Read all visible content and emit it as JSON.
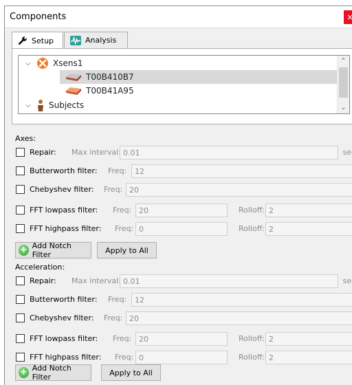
{
  "window": {
    "title": "Components",
    "close_glyph": "×"
  },
  "tabs": [
    {
      "label": "Setup",
      "icon": "wrench-icon",
      "active": true
    },
    {
      "label": "Analysis",
      "icon": "waveform-icon",
      "active": false
    }
  ],
  "tree": {
    "items": [
      {
        "label": "Xsens1",
        "icon": "xsens-device-icon",
        "expanded": true,
        "level": 0
      },
      {
        "label": "T00B410B7",
        "icon": "sensor-icon",
        "level": 1,
        "selected": true
      },
      {
        "label": "T00B41A95",
        "icon": "sensor-icon",
        "level": 1,
        "selected": false
      },
      {
        "label": "Subjects",
        "icon": "subject-icon",
        "expanded": true,
        "level": 0
      }
    ]
  },
  "sections": [
    {
      "title": "Axes:",
      "repair": {
        "label": "Repair:",
        "field_label": "Max interval:",
        "value": "0.01",
        "unit": "sec"
      },
      "butterworth": {
        "label": "Butterworth filter:",
        "field_label": "Freq:",
        "value": "12"
      },
      "chebyshev": {
        "label": "Chebyshev filter:",
        "field_label": "Freq:",
        "value": "20"
      },
      "fft_lowpass": {
        "label": "FFT lowpass filter:",
        "field_label": "Freq:",
        "value": "20",
        "rolloff_label": "Rolloff:",
        "rolloff": "2"
      },
      "fft_highpass": {
        "label": "FFT highpass filter:",
        "field_label": "Freq:",
        "value": "0",
        "rolloff_label": "Rolloff:",
        "rolloff": "2"
      },
      "add_notch_label": "Add Notch Filter",
      "apply_all_label": "Apply to All"
    },
    {
      "title": "Acceleration:",
      "repair": {
        "label": "Repair:",
        "field_label": "Max interval:",
        "value": "0.01",
        "unit": "sec"
      },
      "butterworth": {
        "label": "Butterworth filter:",
        "field_label": "Freq:",
        "value": "12"
      },
      "chebyshev": {
        "label": "Chebyshev filter:",
        "field_label": "Freq:",
        "value": "20"
      },
      "fft_lowpass": {
        "label": "FFT lowpass filter:",
        "field_label": "Freq:",
        "value": "20",
        "rolloff_label": "Rolloff:",
        "rolloff": "2"
      },
      "fft_highpass": {
        "label": "FFT highpass filter:",
        "field_label": "Freq:",
        "value": "0",
        "rolloff_label": "Rolloff:",
        "rolloff": "2"
      },
      "add_notch_label": "Add Notch Filter",
      "apply_all_label": "Apply to All"
    }
  ],
  "colors": {
    "close": "#e81123",
    "selected_row": "#d9d9d9",
    "field_bg": "#f5f5f5"
  }
}
